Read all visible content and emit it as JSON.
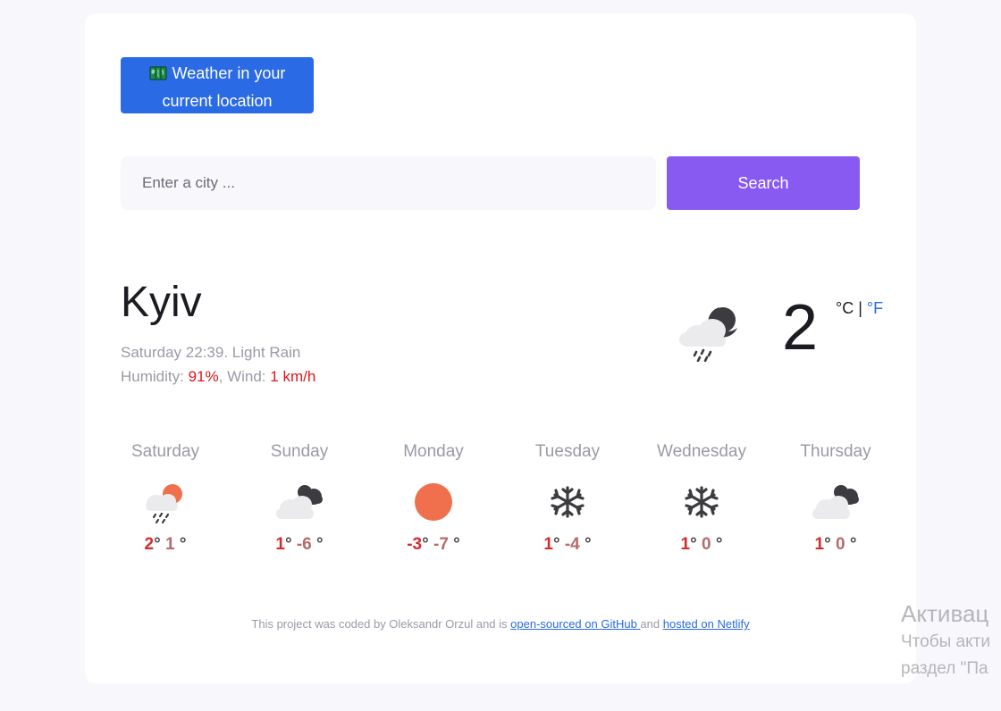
{
  "location_button": {
    "label_line1": "Weather in your",
    "label_line2": "current location",
    "icon": "world-map-icon"
  },
  "search": {
    "placeholder": "Enter a city ...",
    "value": "",
    "button_label": "Search"
  },
  "current": {
    "city": "Kyiv",
    "day_time": "Saturday 22:39",
    "description": "Light Rain",
    "humidity_label": "Humidity:",
    "humidity": "91%",
    "wind_label": "Wind:",
    "wind": "1 km/h",
    "temperature": "2",
    "unit_c": "°C",
    "unit_sep": "|",
    "unit_f": "°F",
    "icon": "night-rain-icon"
  },
  "forecast": [
    {
      "day": "Saturday",
      "max": "2",
      "min": "1",
      "icon": "sun-rain-icon"
    },
    {
      "day": "Sunday",
      "max": "1",
      "min": "-6",
      "icon": "cloudy-night-icon"
    },
    {
      "day": "Monday",
      "max": "-3",
      "min": "-7",
      "icon": "sun-icon"
    },
    {
      "day": "Tuesday",
      "max": "1",
      "min": "-4",
      "icon": "snowflake-icon"
    },
    {
      "day": "Wednesday",
      "max": "1",
      "min": "0",
      "icon": "snowflake-icon"
    },
    {
      "day": "Thursday",
      "max": "1",
      "min": "0",
      "icon": "cloudy-night-icon"
    }
  ],
  "footer": {
    "text_before": "This project was coded by Oleksandr Orzul and is ",
    "github_link": "open-sourced on GitHub ",
    "text_middle": "and ",
    "netlify_link": "hosted on Netlify"
  },
  "watermark": {
    "line1": "Активац",
    "line2": "Чтобы акти",
    "line3": "раздел \"Па"
  },
  "colors": {
    "primary": "#2a6ae4",
    "accent": "#885af2",
    "highlight": "#e0151b",
    "sun": "#f0704d"
  }
}
